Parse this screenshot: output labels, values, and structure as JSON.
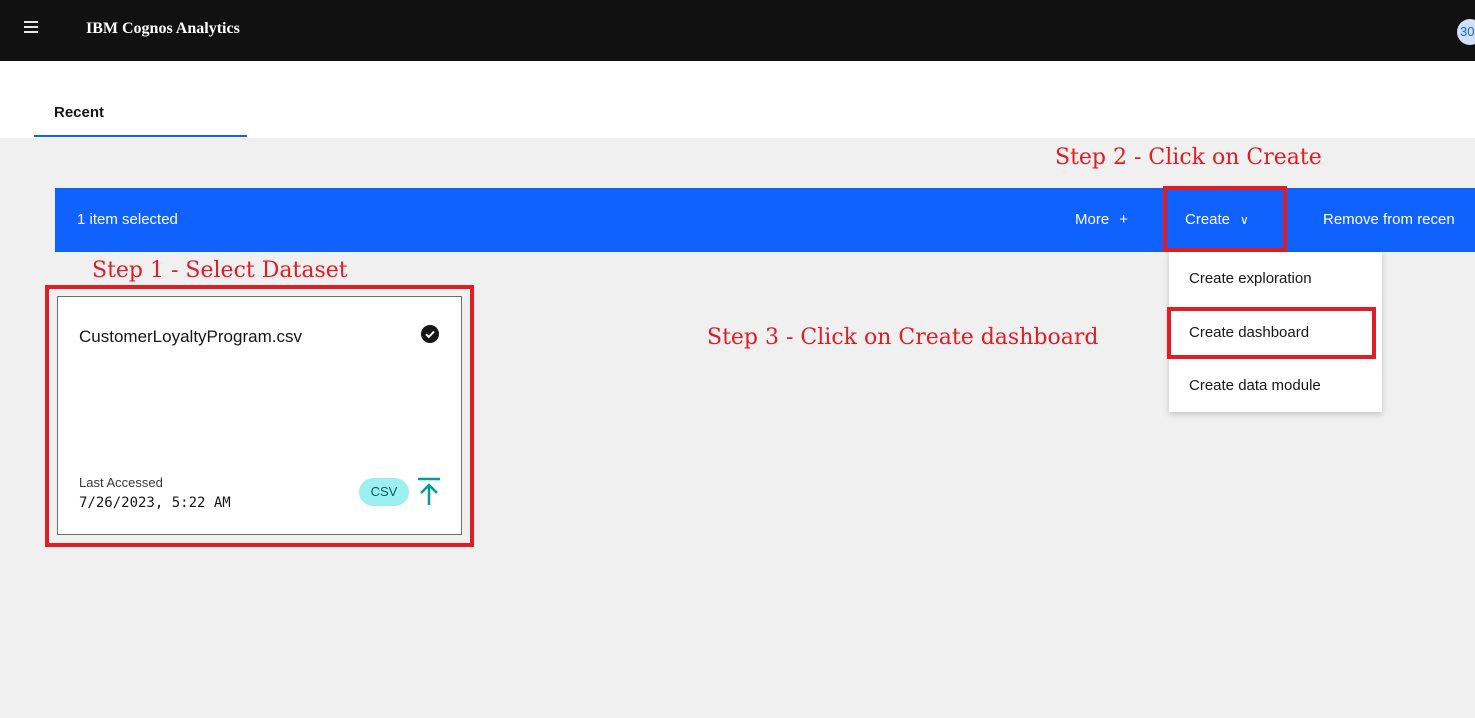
{
  "header": {
    "app_title": "IBM Cognos Analytics",
    "avatar_text": "30"
  },
  "tabs": [
    {
      "label": "Recent"
    }
  ],
  "selection_bar": {
    "count_text": "1 item selected",
    "more_label": "More",
    "more_icon": "+",
    "create_label": "Create",
    "remove_label": "Remove from recen"
  },
  "create_menu": {
    "items": [
      {
        "label": "Create exploration"
      },
      {
        "label": "Create dashboard"
      },
      {
        "label": "Create data module"
      }
    ]
  },
  "card": {
    "title": "CustomerLoyaltyProgram.csv",
    "last_accessed_label": "Last Accessed",
    "last_accessed_value": "7/26/2023, 5:22 AM",
    "badge": "CSV"
  },
  "annotations": {
    "step1": "Step 1 - Select Dataset",
    "step2": "Step 2 - Click on Create",
    "step3": "Step 3 - Click on Create dashboard"
  },
  "colors": {
    "accent_blue": "#0f62fe",
    "annotation_red": "#e31b23",
    "topbar": "#111111",
    "badge_bg": "#9ef0f0",
    "upload_teal": "#009d9a"
  }
}
